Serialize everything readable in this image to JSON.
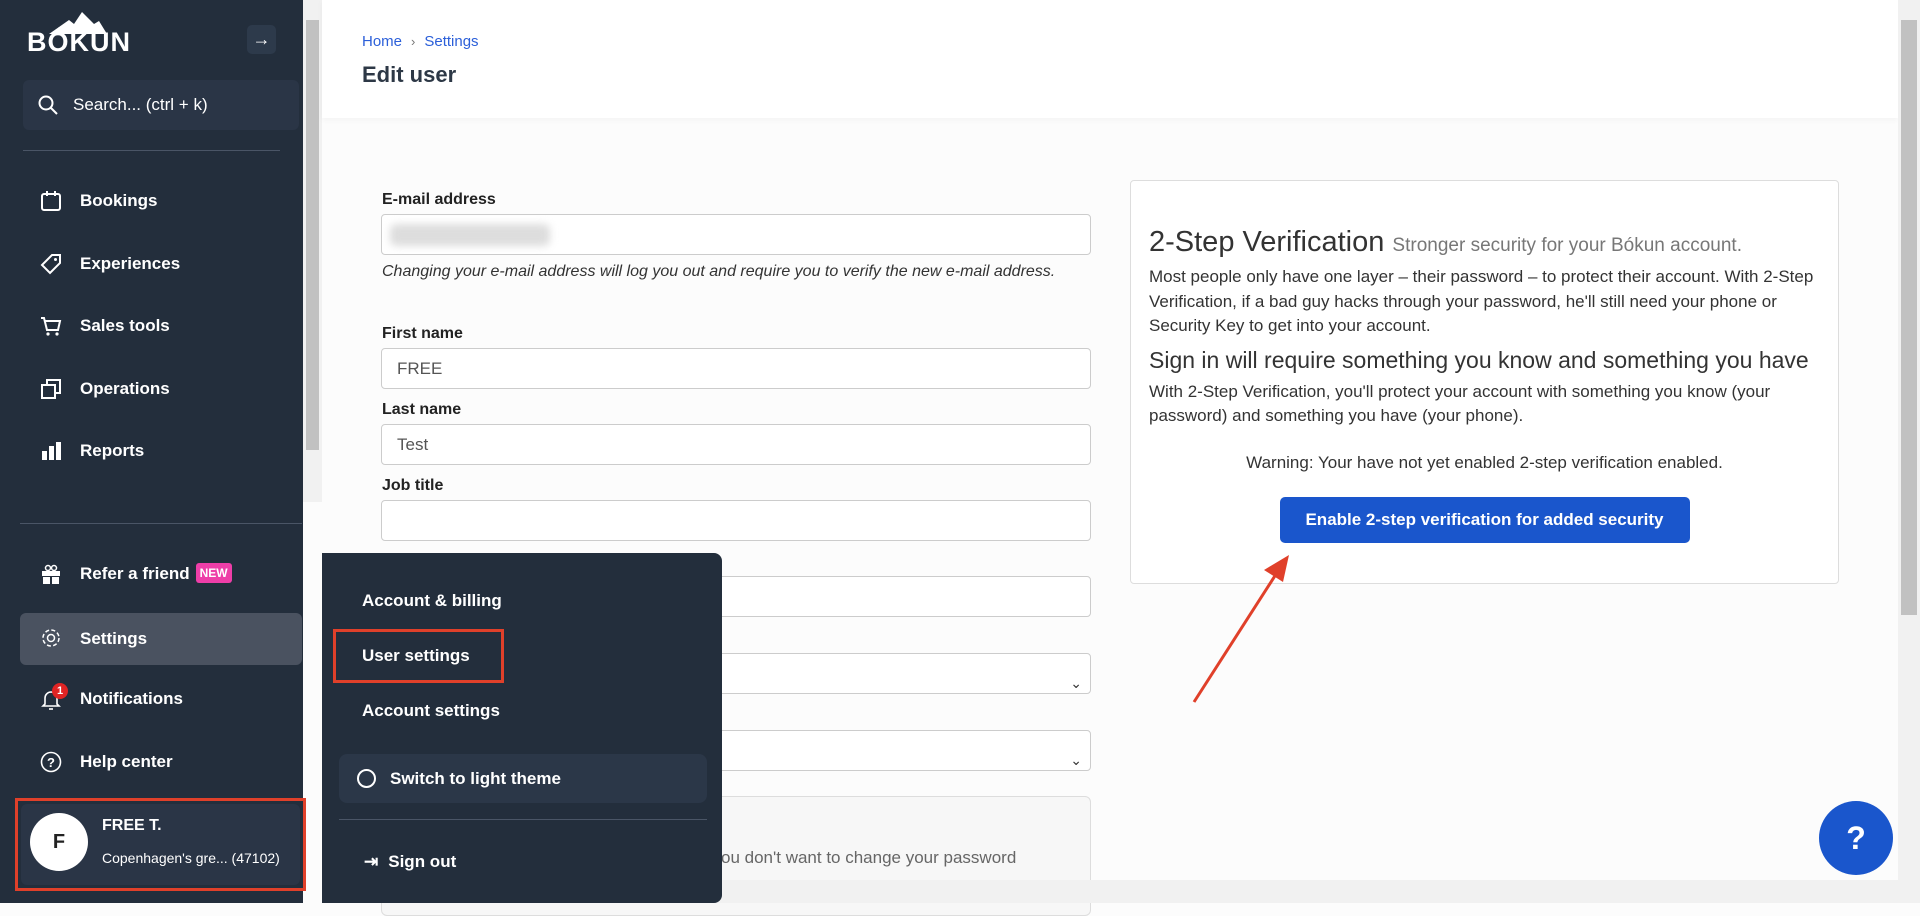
{
  "sidebar": {
    "logo": "BÓKUN",
    "search_placeholder": "Search... (ctrl + k)",
    "nav": [
      {
        "label": "Bookings",
        "icon": "calendar-icon"
      },
      {
        "label": "Experiences",
        "icon": "tag-icon"
      },
      {
        "label": "Sales tools",
        "icon": "cart-icon"
      },
      {
        "label": "Operations",
        "icon": "copy-icon"
      },
      {
        "label": "Reports",
        "icon": "bar-chart-icon"
      }
    ],
    "bottom": {
      "refer": "Refer a friend",
      "new_badge": "NEW",
      "settings": "Settings",
      "notifications": "Notifications",
      "notification_count": "1",
      "help": "Help center"
    },
    "user": {
      "initial": "F",
      "name": "FREE T.",
      "org": "Copenhagen's gre...",
      "id": "(47102)"
    }
  },
  "popup": {
    "account_billing": "Account & billing",
    "user_settings": "User settings",
    "account_settings": "Account settings",
    "theme": "Switch to light theme",
    "sign_out": "Sign out"
  },
  "header": {
    "breadcrumb": [
      "Home",
      "Settings"
    ],
    "title": "Edit user"
  },
  "form": {
    "email_label": "E-mail address",
    "email_help": "Changing your e-mail address will log you out and require you to verify the new e-mail address.",
    "first_name_label": "First name",
    "first_name": "FREE",
    "last_name_label": "Last name",
    "last_name": "Test",
    "job_title_label": "Job title",
    "job_title": "",
    "password_hint": "ou don't want to change your password"
  },
  "two_step": {
    "title": "2-Step Verification",
    "subtitle": "Stronger security for your Bókun account.",
    "intro": "Most people only have one layer – their password – to protect their account. With 2-Step Verification, if a bad guy hacks through your password, he'll still need your phone or Security Key to get into your account.",
    "heading": "Sign in will require something you know and something you have",
    "body": "With 2-Step Verification, you'll protect your account with something you know (your password) and something you have (your phone).",
    "warning": "Warning: Your have not yet enabled 2-step verification enabled.",
    "button": "Enable 2-step verification for added security"
  },
  "help_button": "?",
  "colors": {
    "sidebar": "#232e3c",
    "primary": "#1a56cc",
    "highlight": "#e0402a",
    "new_badge": "#ee3ea8"
  }
}
